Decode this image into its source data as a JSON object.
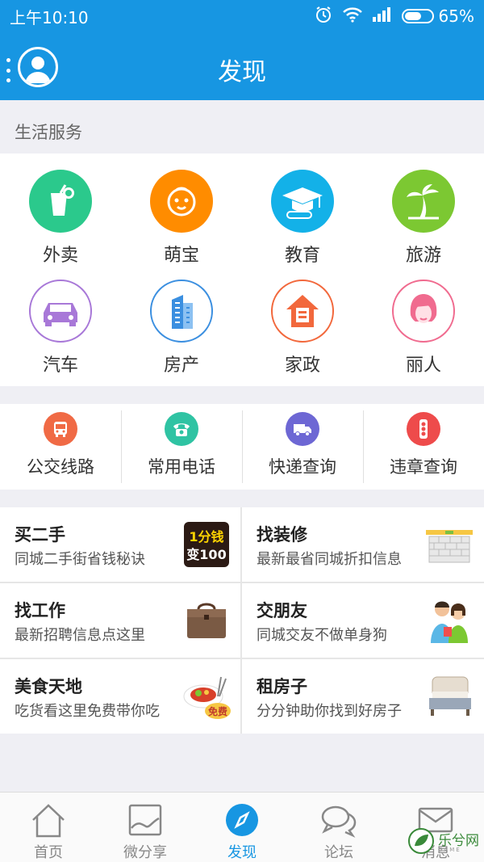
{
  "status_bar": {
    "time": "上午10:10",
    "battery": "65%",
    "battery_level": 0.65
  },
  "header": {
    "title": "发现",
    "menu_icon": "more-vertical-icon",
    "avatar_icon": "user-avatar-icon"
  },
  "section_title": "生活服务",
  "services": [
    {
      "label": "外卖",
      "icon": "drink-icon",
      "color": "#2bc98c"
    },
    {
      "label": "萌宝",
      "icon": "baby-icon",
      "color": "#ff8c00"
    },
    {
      "label": "教育",
      "icon": "graduation-cap-icon",
      "color": "#13b1e8"
    },
    {
      "label": "旅游",
      "icon": "palm-tree-icon",
      "color": "#7cc832"
    },
    {
      "label": "汽车",
      "icon": "car-icon",
      "color": "#a878d8"
    },
    {
      "label": "房产",
      "icon": "building-icon",
      "color": "#3b8fe0"
    },
    {
      "label": "家政",
      "icon": "house-icon",
      "color": "#f2683c"
    },
    {
      "label": "丽人",
      "icon": "woman-icon",
      "color": "#f06b8f"
    }
  ],
  "quick_links": [
    {
      "label": "公交线路",
      "icon": "bus-icon",
      "color": "#f06a45"
    },
    {
      "label": "常用电话",
      "icon": "phone-icon",
      "color": "#2fc3a3"
    },
    {
      "label": "快递查询",
      "icon": "truck-icon",
      "color": "#6d67d4"
    },
    {
      "label": "违章查询",
      "icon": "traffic-light-icon",
      "color": "#ee4b4b"
    }
  ],
  "cards": [
    {
      "title": "买二手",
      "subtitle": "同城二手街省钱秘诀",
      "thumb": "one-cent-badge-icon",
      "thumb_text": "1分钱",
      "thumb_text2": "变100"
    },
    {
      "title": "找装修",
      "subtitle": "最新最省同城折扣信息",
      "thumb": "brick-wall-icon"
    },
    {
      "title": "找工作",
      "subtitle": "最新招聘信息点这里",
      "thumb": "briefcase-icon"
    },
    {
      "title": "交朋友",
      "subtitle": "同城交友不做单身狗",
      "thumb": "couple-icon"
    },
    {
      "title": "美食天地",
      "subtitle": "吃货看这里免费带你吃",
      "thumb": "food-plate-icon",
      "thumb_text": "免费"
    },
    {
      "title": "租房子",
      "subtitle": "分分钟助你找到好房子",
      "thumb": "bed-icon"
    }
  ],
  "tabs": [
    {
      "label": "首页",
      "icon": "home-icon",
      "active": false
    },
    {
      "label": "微分享",
      "icon": "image-icon",
      "active": false
    },
    {
      "label": "发现",
      "icon": "compass-icon",
      "active": true
    },
    {
      "label": "论坛",
      "icon": "chat-bubbles-icon",
      "active": false
    },
    {
      "label": "消息",
      "icon": "mail-icon",
      "active": false
    }
  ],
  "watermark": {
    "text": "乐兮网",
    "sub": "GAME"
  },
  "colors": {
    "primary": "#1796e2",
    "background": "#efeff4"
  }
}
